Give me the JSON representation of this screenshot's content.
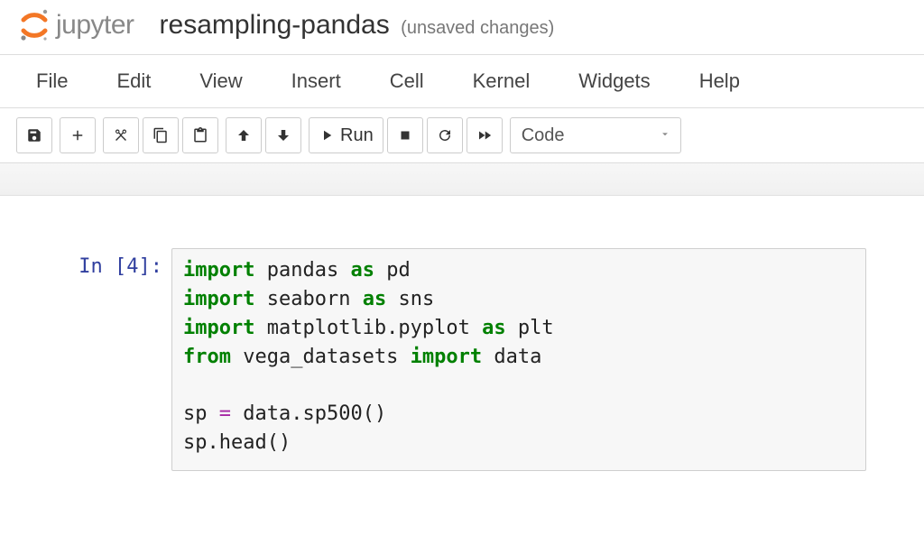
{
  "header": {
    "logo_text": "jupyter",
    "notebook_title": "resampling-pandas",
    "save_status": "(unsaved changes)"
  },
  "menubar": {
    "items": [
      "File",
      "Edit",
      "View",
      "Insert",
      "Cell",
      "Kernel",
      "Widgets",
      "Help"
    ]
  },
  "toolbar": {
    "run_label": "Run",
    "cell_type_selected": "Code",
    "icons": {
      "save": "save-icon",
      "add": "plus-icon",
      "cut": "scissors-icon",
      "copy": "copy-icon",
      "paste": "paste-icon",
      "up": "arrow-up-icon",
      "down": "arrow-down-icon",
      "run": "play-icon",
      "stop": "stop-icon",
      "restart": "restart-icon",
      "ff": "fast-forward-icon"
    }
  },
  "cell": {
    "prompt": "In [4]:",
    "code_tokens": [
      {
        "t": "import",
        "c": "kw"
      },
      {
        "t": " pandas "
      },
      {
        "t": "as",
        "c": "kw"
      },
      {
        "t": " pd\n"
      },
      {
        "t": "import",
        "c": "kw"
      },
      {
        "t": " seaborn "
      },
      {
        "t": "as",
        "c": "kw"
      },
      {
        "t": " sns\n"
      },
      {
        "t": "import",
        "c": "kw"
      },
      {
        "t": " matplotlib.pyplot "
      },
      {
        "t": "as",
        "c": "kw"
      },
      {
        "t": " plt\n"
      },
      {
        "t": "from",
        "c": "kw"
      },
      {
        "t": " vega_datasets "
      },
      {
        "t": "import",
        "c": "kw"
      },
      {
        "t": " data\n"
      },
      {
        "t": "\n"
      },
      {
        "t": "sp "
      },
      {
        "t": "=",
        "c": "op"
      },
      {
        "t": " data.sp500()\n"
      },
      {
        "t": "sp.head()"
      }
    ]
  }
}
